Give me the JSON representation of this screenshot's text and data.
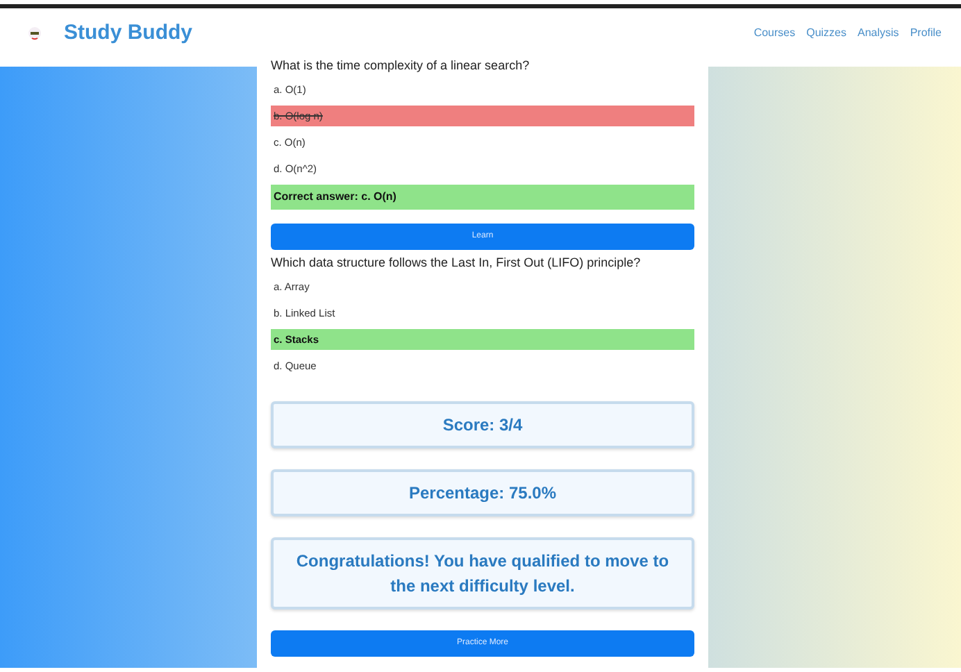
{
  "brand": "Study Buddy",
  "nav": [
    {
      "label": "Courses"
    },
    {
      "label": "Quizzes"
    },
    {
      "label": "Analysis"
    },
    {
      "label": "Profile"
    }
  ],
  "questions": [
    {
      "question": "What is the time complexity of a linear search?",
      "options": [
        {
          "text": "a. O(1)",
          "selected": false,
          "correct": false
        },
        {
          "text": "b. O(log n)",
          "selected": true,
          "correct": false
        },
        {
          "text": "c. O(n)",
          "selected": false,
          "correct": false
        },
        {
          "text": "d. O(n^2)",
          "selected": false,
          "correct": false
        }
      ],
      "correct_answer": "Correct answer: c. O(n)",
      "button": "Learn"
    },
    {
      "question": "Which data structure follows the Last In, First Out (LIFO) principle?",
      "options": [
        {
          "text": "a. Array",
          "selected": false,
          "correct": false
        },
        {
          "text": "b. Linked List",
          "selected": false,
          "correct": false
        },
        {
          "text": "c. Stacks",
          "selected": true,
          "correct": true
        },
        {
          "text": "d. Queue",
          "selected": false,
          "correct": false
        }
      ]
    }
  ],
  "results": [
    "Score: 3/4",
    "Percentage: 75.0%",
    "Congratulations! You have qualified to move to the next difficulty level."
  ],
  "practice_button": "Practice More"
}
